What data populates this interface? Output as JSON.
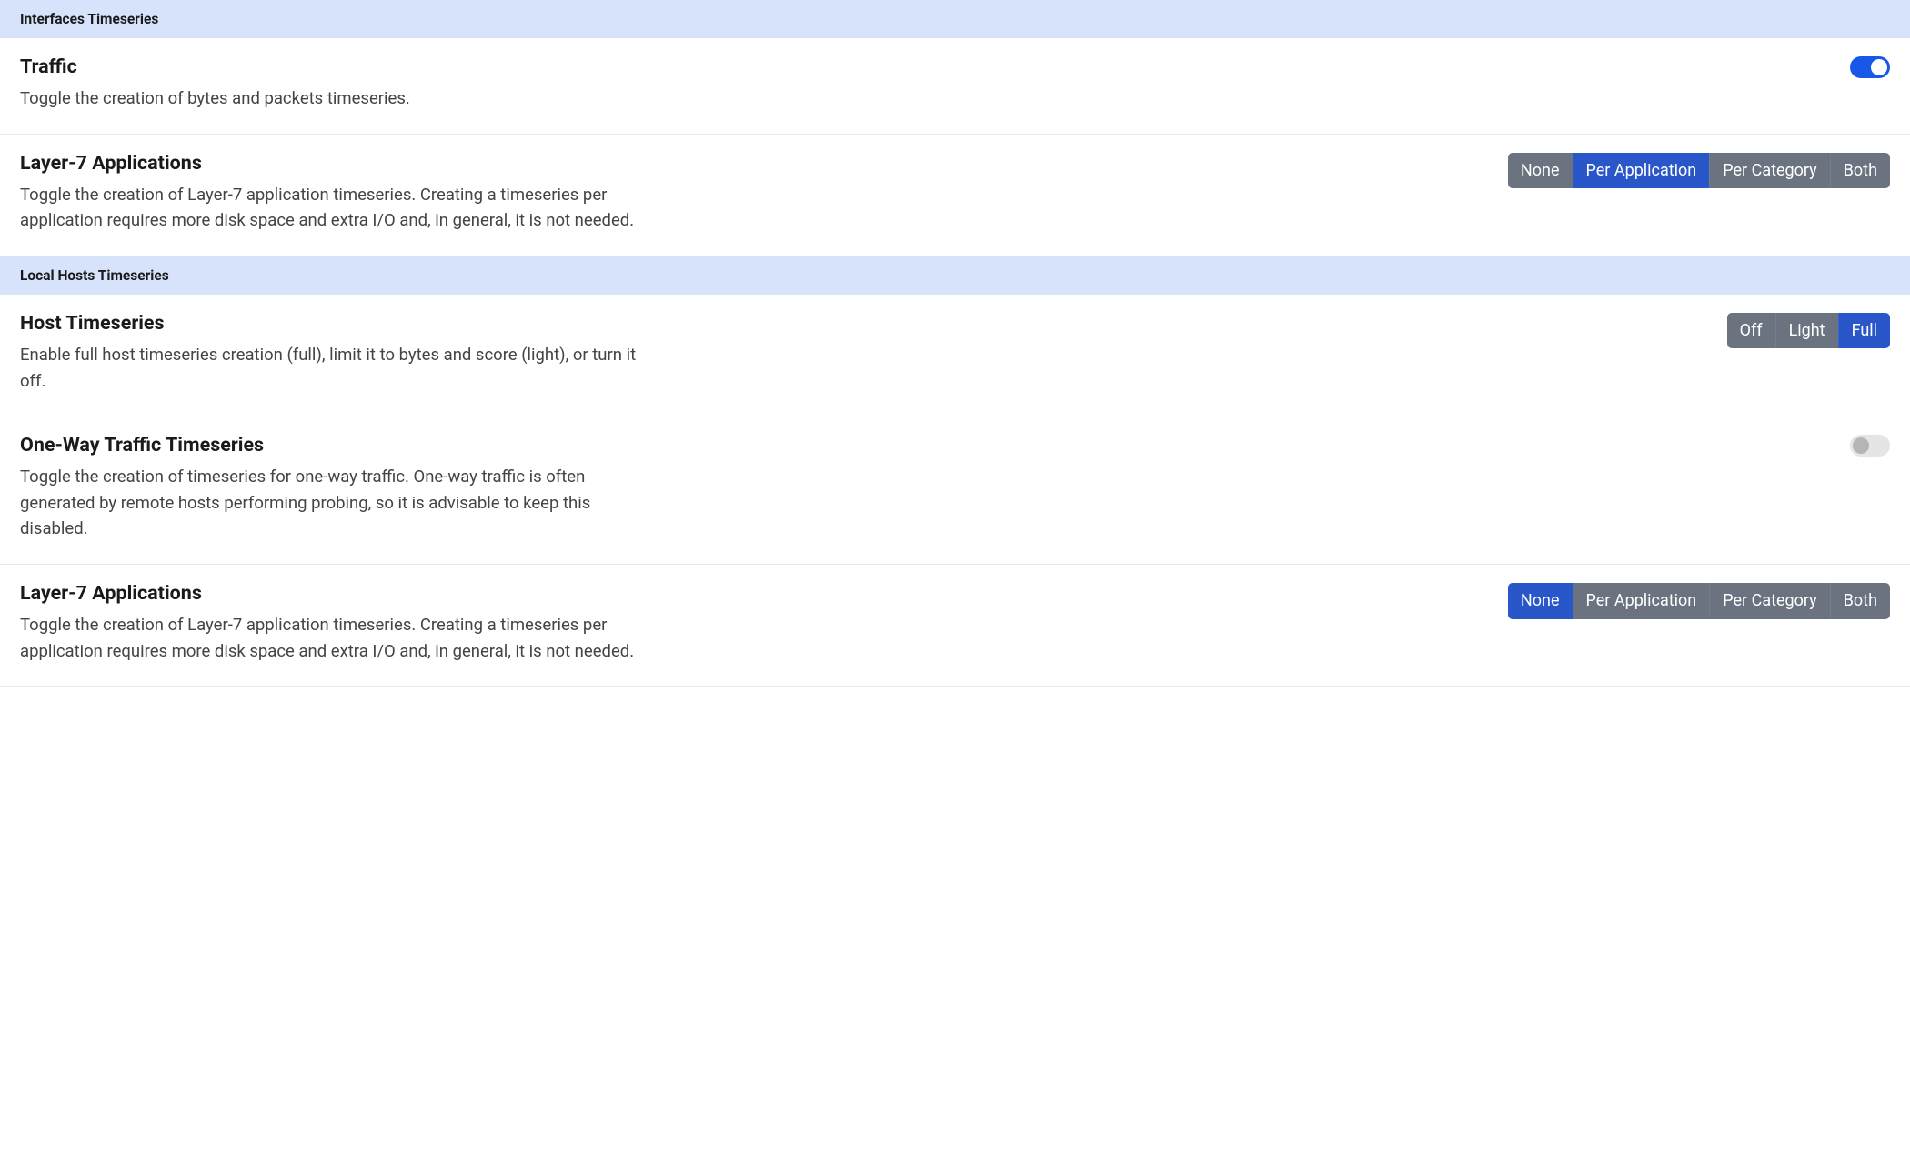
{
  "sections": [
    {
      "header": "Interfaces Timeseries",
      "settings": [
        {
          "title": "Traffic",
          "description": "Toggle the creation of bytes and packets timeseries.",
          "control": {
            "type": "toggle",
            "on": true
          }
        },
        {
          "title": "Layer-7 Applications",
          "description": "Toggle the creation of Layer-7 application timeseries. Creating a timeseries per application requires more disk space and extra I/O and, in general, it is not needed.",
          "control": {
            "type": "btngroup",
            "options": [
              "None",
              "Per Application",
              "Per Category",
              "Both"
            ],
            "active": 1
          }
        }
      ]
    },
    {
      "header": "Local Hosts Timeseries",
      "settings": [
        {
          "title": "Host Timeseries",
          "description": "Enable full host timeseries creation (full), limit it to bytes and score (light), or turn it off.",
          "control": {
            "type": "btngroup",
            "options": [
              "Off",
              "Light",
              "Full"
            ],
            "active": 2
          }
        },
        {
          "title": "One-Way Traffic Timeseries",
          "description": "Toggle the creation of timeseries for one-way traffic. One-way traffic is often generated by remote hosts performing probing, so it is advisable to keep this disabled.",
          "control": {
            "type": "toggle",
            "on": false
          }
        },
        {
          "title": "Layer-7 Applications",
          "description": "Toggle the creation of Layer-7 application timeseries. Creating a timeseries per application requires more disk space and extra I/O and, in general, it is not needed.",
          "control": {
            "type": "btngroup",
            "options": [
              "None",
              "Per Application",
              "Per Category",
              "Both"
            ],
            "active": 0
          }
        }
      ]
    }
  ]
}
